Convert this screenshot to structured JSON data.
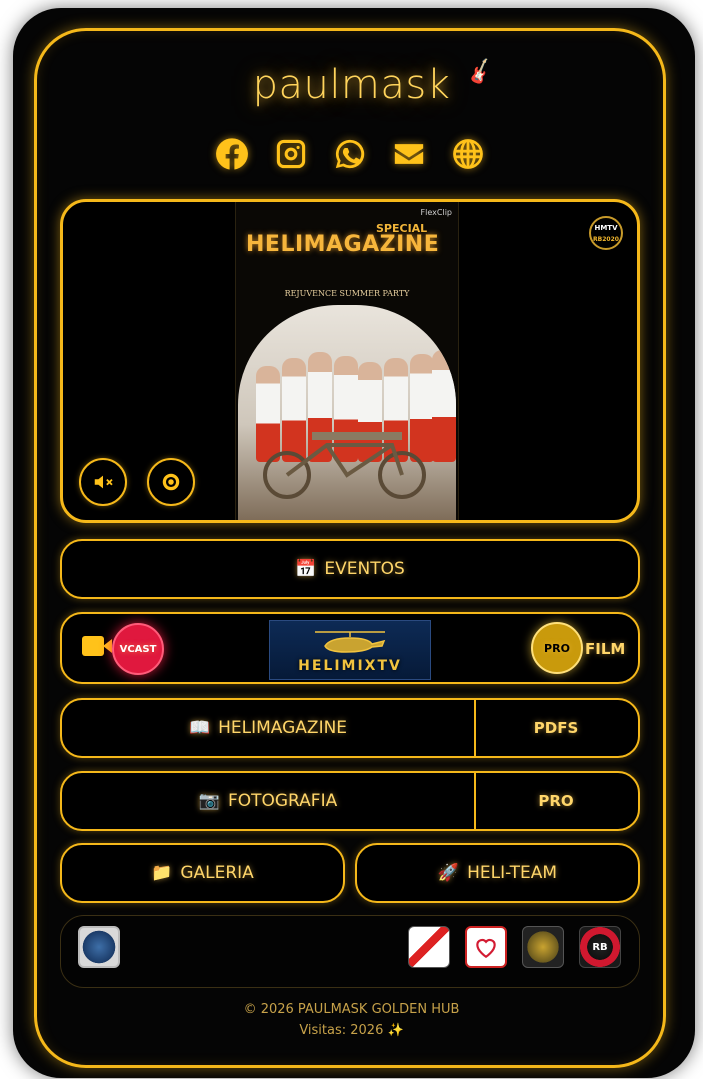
{
  "brand": {
    "name": "paulmask"
  },
  "socials": [
    "facebook-icon",
    "instagram-icon",
    "whatsapp-icon",
    "mail-icon",
    "globe-icon"
  ],
  "player": {
    "poster": {
      "watermark": "FlexClip",
      "special": "SPECIAL",
      "title": "HELIMAGAZINE",
      "subtitle": "REJUVENCE SUMMER PARTY"
    },
    "badge_top": "HMTV",
    "badge_bottom": "RB2020",
    "mute_icon": "mute-icon",
    "view_icon": "eye-icon"
  },
  "menu": {
    "eventos": {
      "emoji": "📅",
      "label": "EVENTOS"
    },
    "vcast": {
      "label": "VCAST"
    },
    "helimix": {
      "label": "HELIMIXTV"
    },
    "pro_film": {
      "badge": "PRO",
      "label": "FILM"
    },
    "helimagazine": {
      "emoji": "📖",
      "label": "HELIMAGAZINE",
      "side": "PDFS"
    },
    "fotografia": {
      "emoji": "📷",
      "label": "FOTOGRAFIA",
      "side": "PRO"
    },
    "galeria": {
      "emoji": "📁",
      "label": "GALERIA"
    },
    "heliteam": {
      "emoji": "🚀",
      "label": "HELI-TEAM"
    }
  },
  "partners": {
    "left_logo": "magazine-seal-logo",
    "right_logos": [
      "paco-de-cites-logo",
      "heart-logo",
      "crest-logo",
      "rb-logo"
    ]
  },
  "footer": {
    "copyright": "© 2026 PAULMASK GOLDEN HUB",
    "visits": "Visitas: 2026 ✨"
  },
  "colors": {
    "accent": "#f5b81a",
    "text": "#ffd66a",
    "vcast": "#e0183e",
    "pro": "#c99a0c"
  }
}
